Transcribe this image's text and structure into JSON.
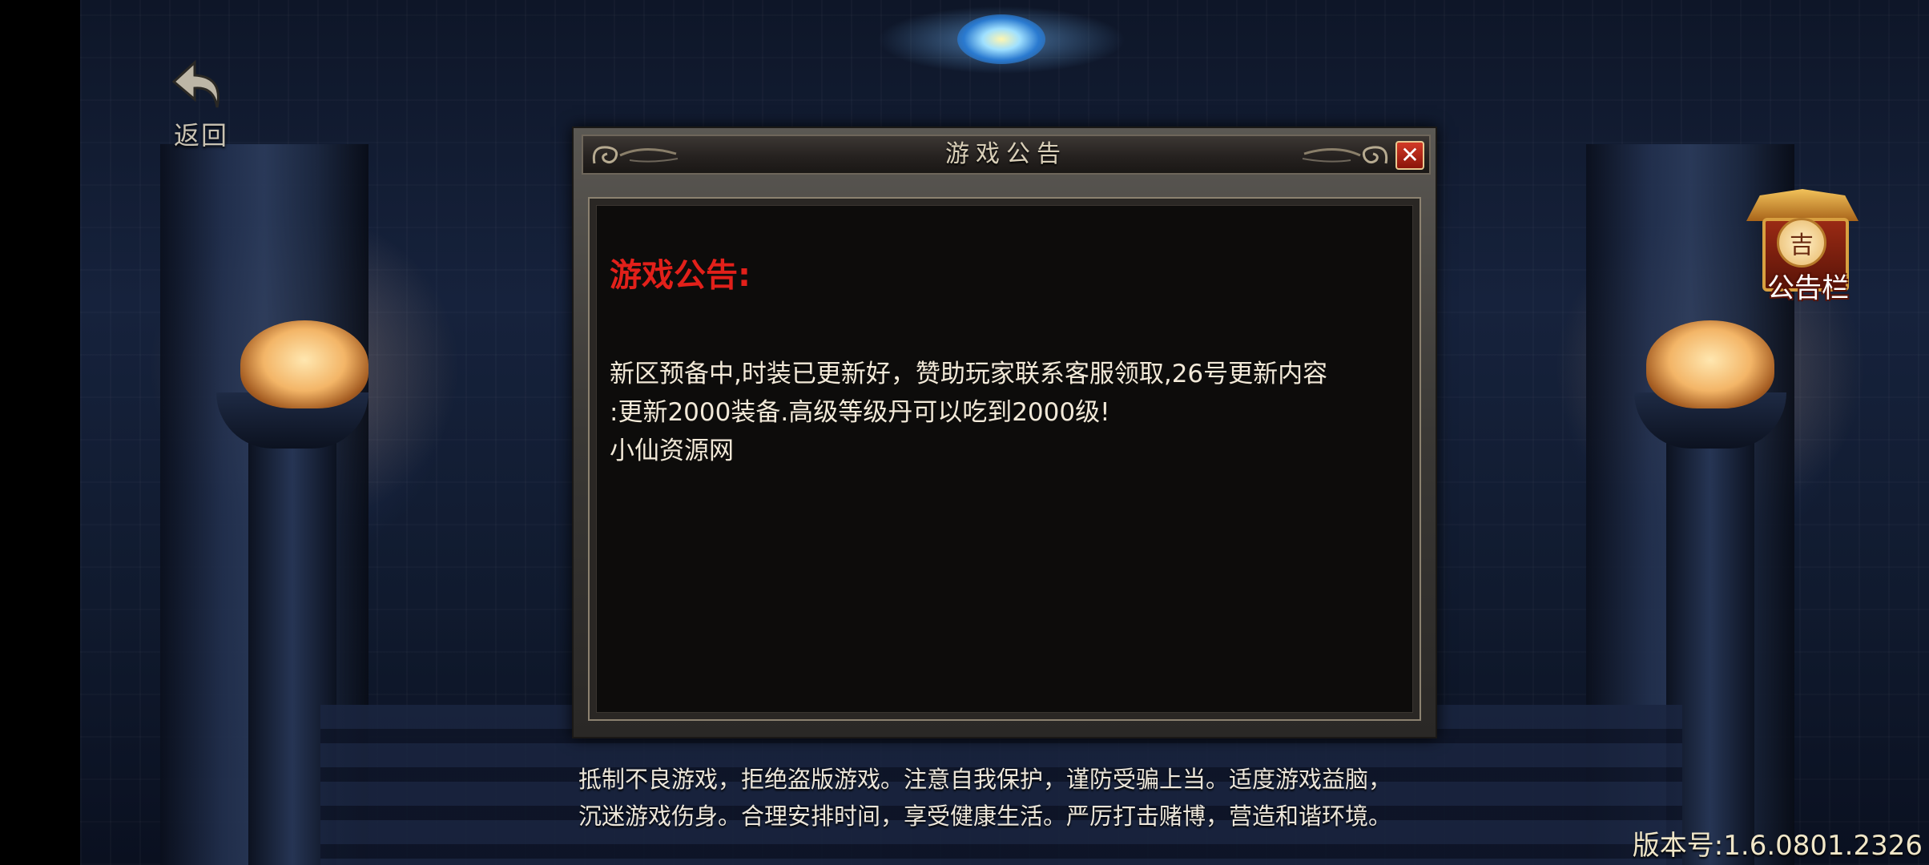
{
  "back_button": {
    "label": "返回"
  },
  "notice_board_button": {
    "seal_char": "吉",
    "label": "公告栏"
  },
  "dialog": {
    "title": "游戏公告",
    "close_symbol": "✕",
    "heading": "游戏公告:",
    "body_lines": [
      "新区预备中,时装已更新好，赞助玩家联系客服领取,26号更新内容",
      ":更新2000装备.高级等级丹可以吃到2000级!",
      "小仙资源网"
    ]
  },
  "health_notice": {
    "lines": [
      "抵制不良游戏，拒绝盗版游戏。注意自我保护，谨防受骗上当。适度游戏益脑，",
      "沉迷游戏伤身。合理安排时间，享受健康生活。严厉打击赌博，营造和谐环境。"
    ]
  },
  "version": {
    "text": "版本号:1.6.0801.2326"
  },
  "colors": {
    "heading_red": "#e2201a",
    "body_text": "#f2e9d8",
    "close_red": "#c42a1c"
  }
}
